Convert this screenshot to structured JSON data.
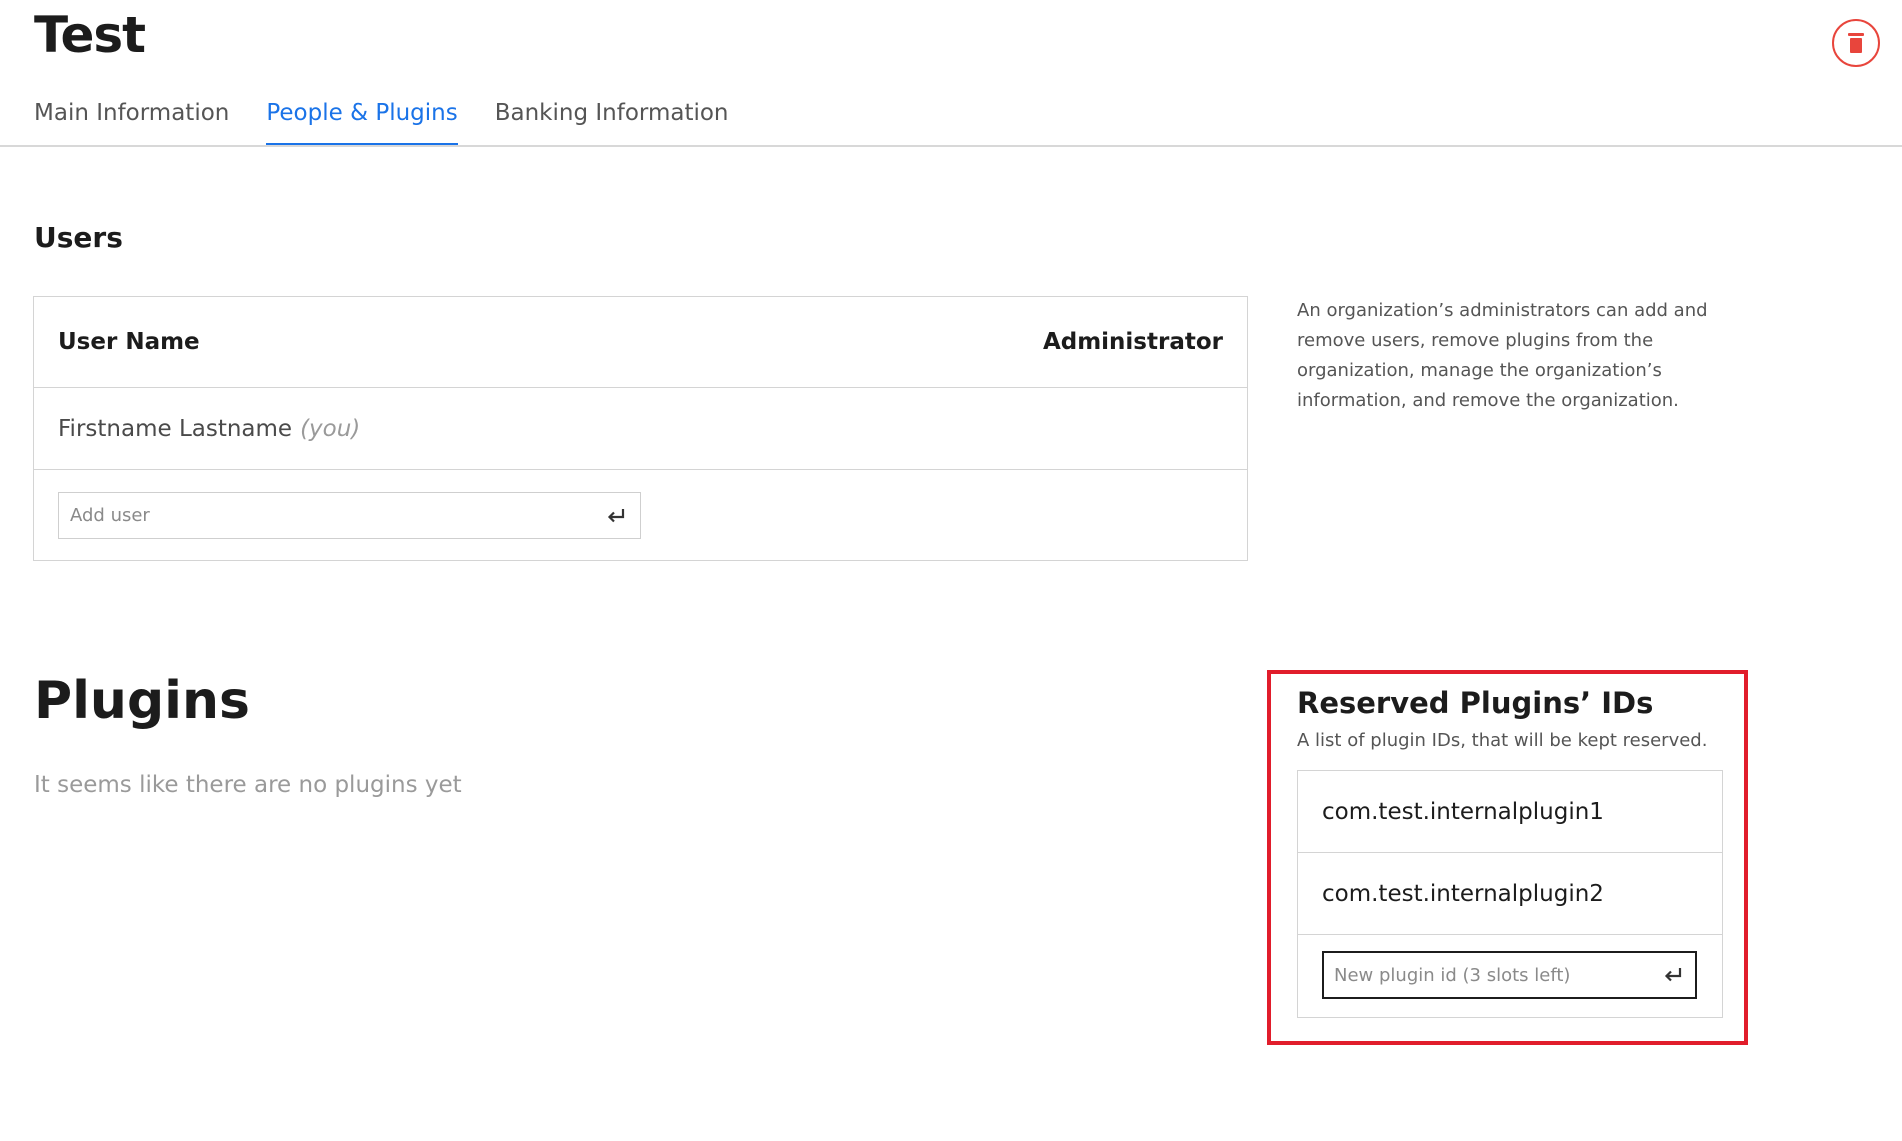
{
  "header": {
    "title": "Test",
    "delete_icon": "trash-icon"
  },
  "tabs": [
    {
      "label": "Main Information",
      "active": false
    },
    {
      "label": "People & Plugins",
      "active": true
    },
    {
      "label": "Banking Information",
      "active": false
    }
  ],
  "users": {
    "heading": "Users",
    "columns": {
      "name": "User Name",
      "admin": "Administrator"
    },
    "rows": [
      {
        "name": "Firstname Lastname",
        "tag": "(you)"
      }
    ],
    "add_placeholder": "Add user",
    "add_icon": "enter-icon",
    "help_text": "An organization’s administrators can add and remove users, remove plugins from the organization, manage the organization’s information, and remove the organization."
  },
  "plugins": {
    "heading": "Plugins",
    "empty_text": "It seems like there are no plugins yet"
  },
  "reserved": {
    "title": "Reserved Plugins’ IDs",
    "subtitle": "A list of plugin IDs, that will be kept reserved.",
    "items": [
      "com.test.internalplugin1",
      "com.test.internalplugin2"
    ],
    "new_placeholder": "New plugin id (3 slots left)",
    "add_icon": "enter-icon"
  },
  "colors": {
    "accent": "#1a73e8",
    "danger": "#e8453c",
    "highlight": "#e11d2b"
  }
}
